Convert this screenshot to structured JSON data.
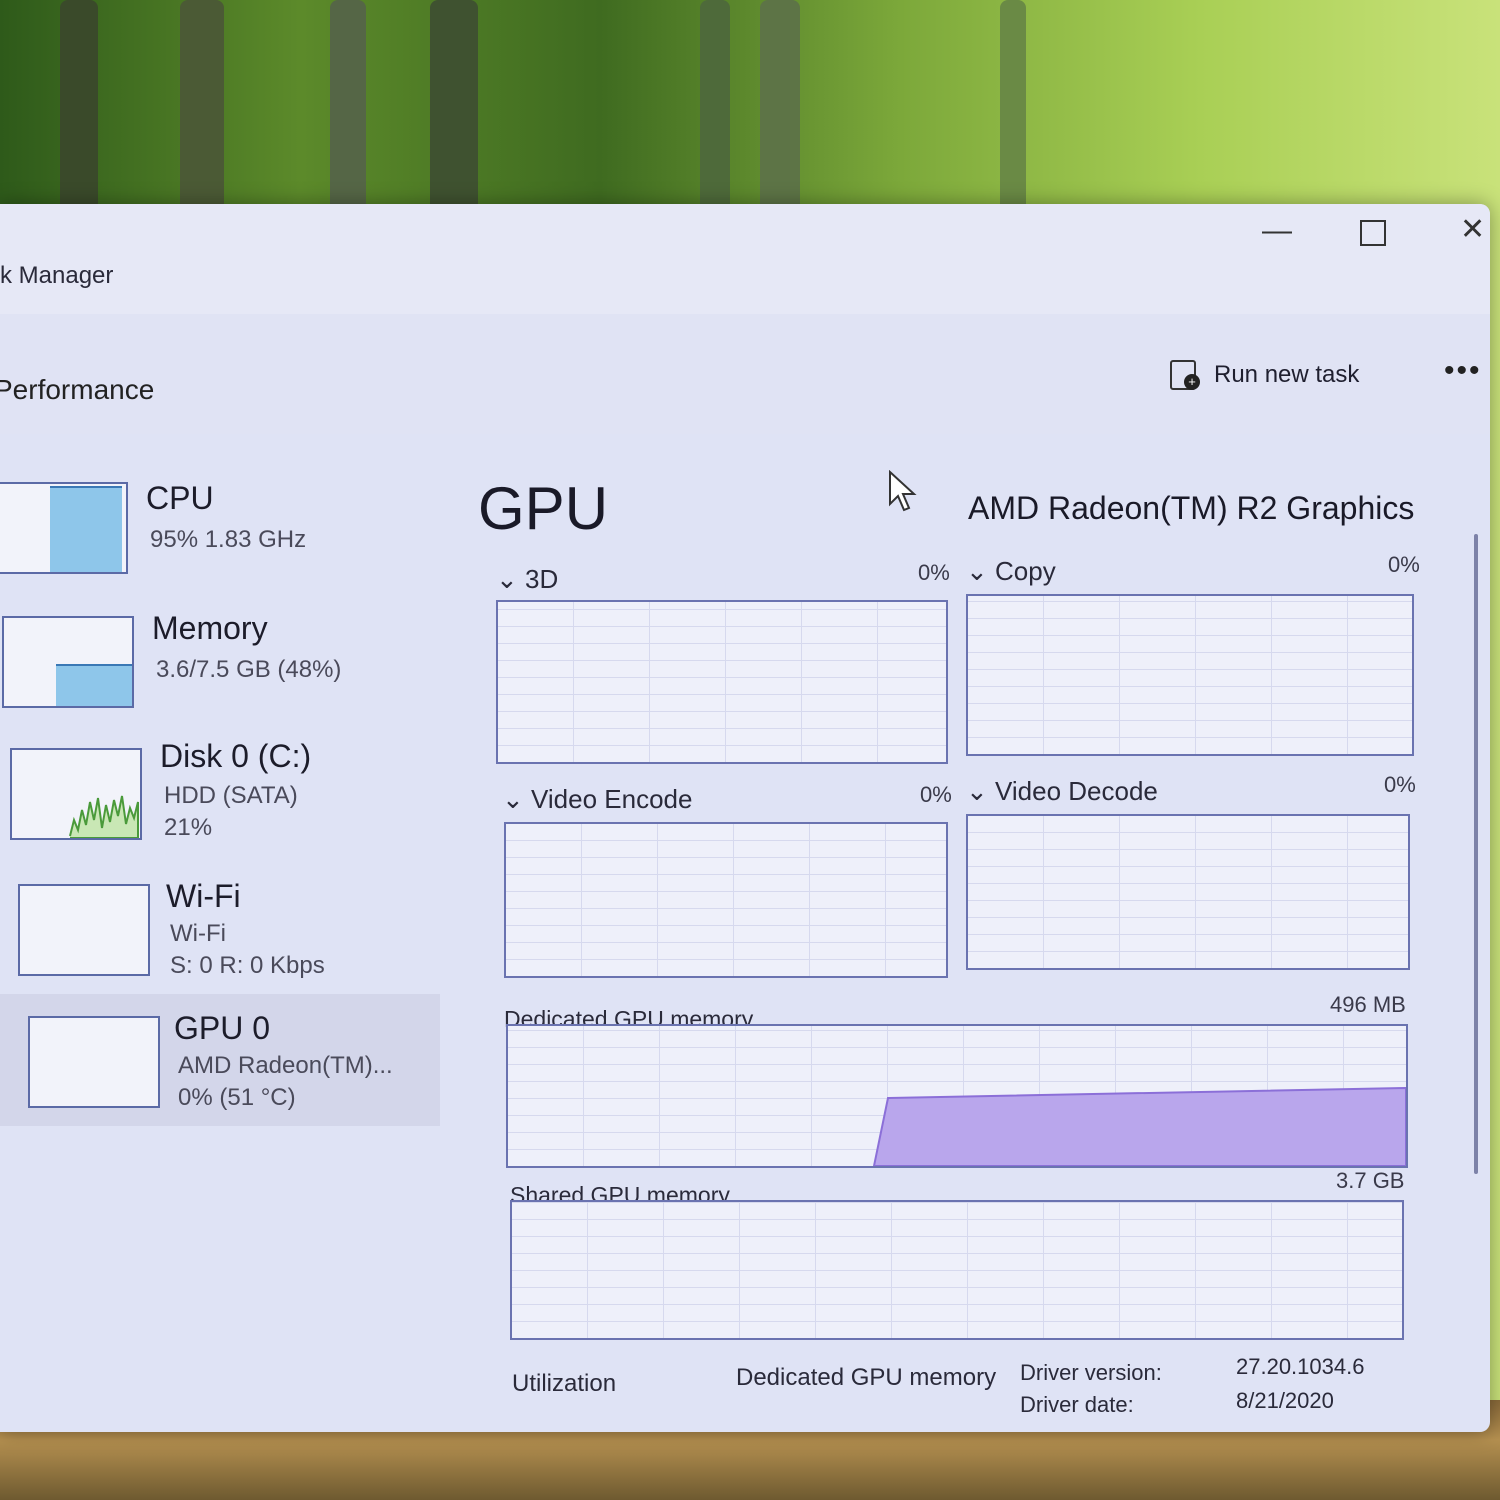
{
  "window": {
    "title": "k Manager",
    "controls": {
      "minimize": "—",
      "close": "✕"
    }
  },
  "header": {
    "section_title": "Performance",
    "run_new_task_label": "Run new task",
    "more_label": "•••"
  },
  "sidebar": {
    "items": [
      {
        "name": "CPU",
        "sub1": "95% 1.83 GHz",
        "sub2": "",
        "sub3": "",
        "level": 0.95
      },
      {
        "name": "Memory",
        "sub1": "3.6/7.5 GB (48%)",
        "sub2": "",
        "sub3": "",
        "level": 0.48
      },
      {
        "name": "Disk 0 (C:)",
        "sub1": "HDD (SATA)",
        "sub2": "21%",
        "sub3": ""
      },
      {
        "name": "Wi-Fi",
        "sub1": "Wi-Fi",
        "sub2": "S: 0 R: 0 Kbps",
        "sub3": ""
      },
      {
        "name": "GPU 0",
        "sub1": "AMD Radeon(TM)...",
        "sub2": "0% (51 °C)",
        "sub3": ""
      }
    ]
  },
  "main": {
    "title": "GPU",
    "model": "AMD Radeon(TM) R2 Graphics",
    "engines": [
      {
        "label": "3D",
        "value": "0%"
      },
      {
        "label": "Copy",
        "value": "0%"
      },
      {
        "label": "Video Encode",
        "value": "0%"
      },
      {
        "label": "Video Decode",
        "value": "0%"
      }
    ],
    "dedicated_memory": {
      "label": "Dedicated GPU memory",
      "max": "496 MB",
      "level": 0.53
    },
    "shared_memory": {
      "label": "Shared GPU memory",
      "max": "3.7 GB"
    },
    "stats": {
      "utilization_label": "Utilization",
      "dedicated_label": "Dedicated GPU memory",
      "driver_version_label": "Driver version:",
      "driver_version_value": "27.20.1034.6",
      "driver_date_label": "Driver date:",
      "driver_date_value": "8/21/2020"
    }
  },
  "colors": {
    "accent": "#5b6aa6",
    "memory_fill": "#b9a6ec",
    "cpu_fill": "#8ec6ea"
  }
}
